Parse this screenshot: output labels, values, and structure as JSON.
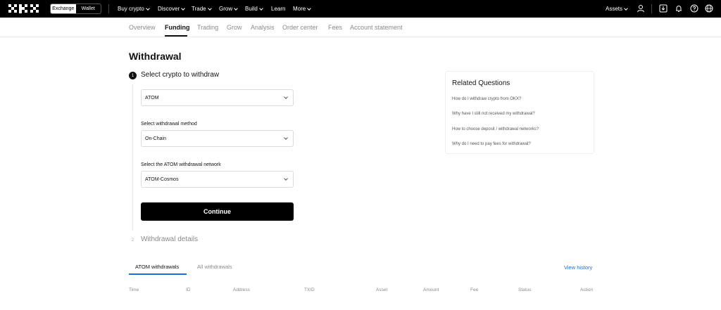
{
  "topnav": {
    "mode_exchange": "Exchange",
    "mode_wallet": "Wallet",
    "items": [
      {
        "label": "Buy crypto",
        "chevron": true
      },
      {
        "label": "Discover",
        "chevron": true
      },
      {
        "label": "Trade",
        "chevron": true
      },
      {
        "label": "Grow",
        "chevron": true
      },
      {
        "label": "Build",
        "chevron": true
      },
      {
        "label": "Learn",
        "chevron": false
      },
      {
        "label": "More",
        "chevron": true
      }
    ],
    "assets_label": "Assets",
    "icons": [
      "user-icon",
      "download-icon",
      "bell-icon",
      "help-icon",
      "globe-icon"
    ]
  },
  "subnav": {
    "items": [
      "Overview",
      "Funding",
      "Trading",
      "Grow",
      "Analysis",
      "Order center",
      "Fees",
      "Account statement"
    ],
    "active": "Funding"
  },
  "page": {
    "title": "Withdrawal",
    "step1_number": "1",
    "step1_title": "Select crypto to withdraw",
    "crypto_value": "ATOM",
    "method_label": "Select withdrawal method",
    "method_value": "On-Chain",
    "network_label": "Select the ATOM withdrawal network",
    "network_value": "ATOM-Cosmos",
    "continue_label": "Continue",
    "step2_number": "2",
    "step2_title": "Withdrawal details"
  },
  "related": {
    "title": "Related Questions",
    "links": [
      "How do I withdraw crypto from OKX?",
      "Why have I still not received my withdrawal?",
      "How to choose deposit / withdrawal networks?",
      "Why do I need to pay fees for withdrawal?"
    ]
  },
  "history": {
    "tab_active": "ATOM withdrawals",
    "tab_inactive": "All withdrawals",
    "view_history": "View history",
    "columns": [
      "Time",
      "ID",
      "Address",
      "TXID",
      "Asset",
      "Amount",
      "Fee",
      "Status",
      "Action"
    ]
  },
  "colors": {
    "accent": "#1a6fd6",
    "nav_bg": "#000000"
  }
}
